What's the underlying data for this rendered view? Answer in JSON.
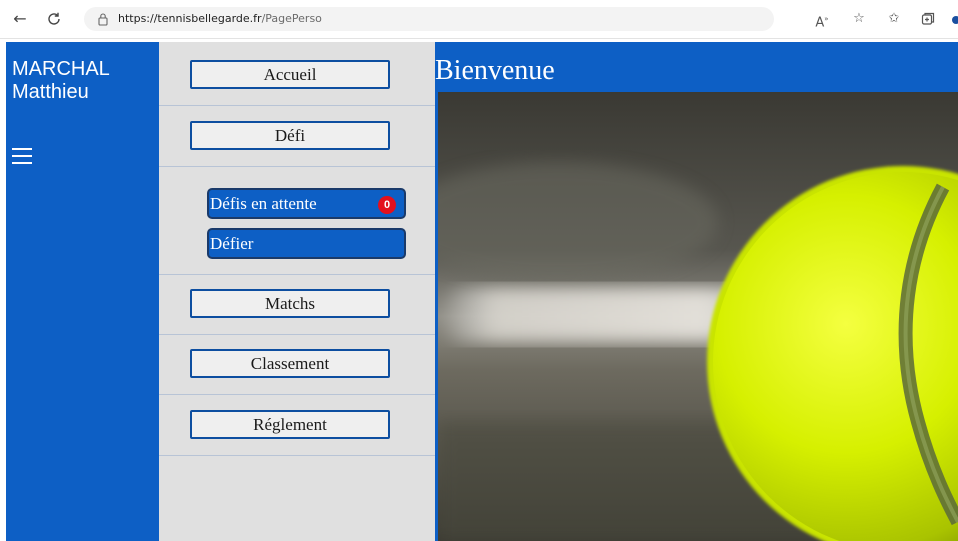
{
  "browser": {
    "back_icon": "arrow-left-icon",
    "refresh_icon": "refresh-icon",
    "url_host": "https://tennisbellegarde.fr",
    "url_path": "/PagePerso",
    "toolbar_icons": [
      "read-aloud-icon",
      "favorite-add-icon",
      "favorites-icon",
      "collections-icon"
    ]
  },
  "user": {
    "last_name": "MARCHAL",
    "first_name": "Matthieu",
    "menu_icon": "hamburger-icon"
  },
  "menu": {
    "items": [
      {
        "label": "Accueil"
      },
      {
        "label": "Défi"
      },
      {
        "label": "Matchs"
      },
      {
        "label": "Classement"
      },
      {
        "label": "Réglement"
      }
    ],
    "sub_items": [
      {
        "label": "Défis en attente",
        "badge": "0"
      },
      {
        "label": "Défier"
      }
    ]
  },
  "content": {
    "title": "Bienvenue",
    "hero_image": "tennis-ball-image"
  },
  "colors": {
    "primary_blue": "#0d5fc5",
    "menu_bg": "#e0e0e0",
    "button_border": "#0d4ea0",
    "badge_red": "#e3101d",
    "ball_yellow": "#d4f000"
  }
}
